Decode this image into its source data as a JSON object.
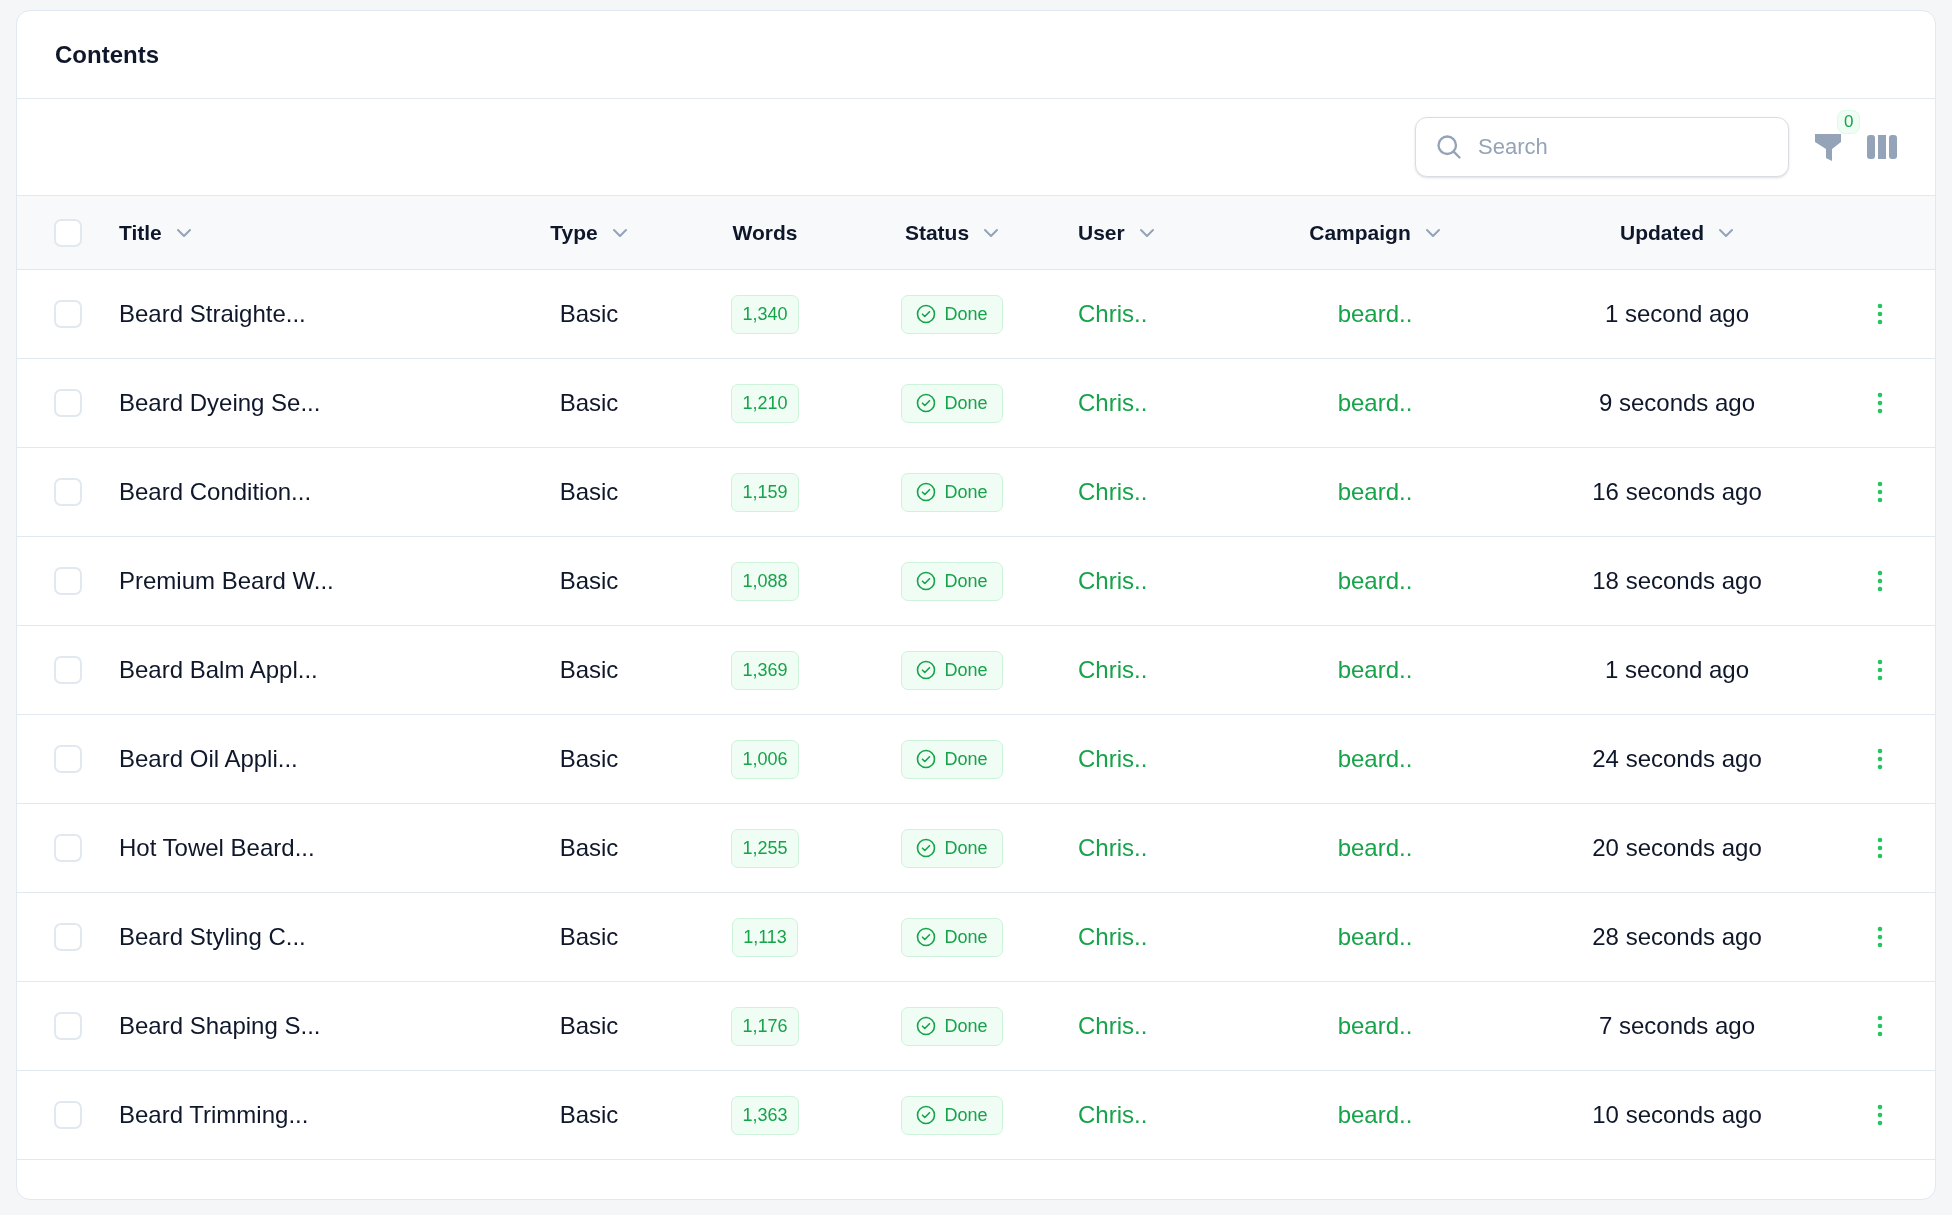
{
  "card_title": "Contents",
  "search": {
    "placeholder": "Search"
  },
  "filter_count": "0",
  "select_all": {
    "checked": false
  },
  "columns": [
    {
      "label": "Title",
      "sortable": true
    },
    {
      "label": "Type",
      "sortable": true
    },
    {
      "label": "Words",
      "sortable": false
    },
    {
      "label": "Status",
      "sortable": true
    },
    {
      "label": "User",
      "sortable": true
    },
    {
      "label": "Campaign",
      "sortable": true
    },
    {
      "label": "Updated",
      "sortable": true
    }
  ],
  "rows": [
    {
      "checked": false,
      "title": "Beard Straighte...",
      "type": "Basic",
      "words": "1,340",
      "status": "Done",
      "user": "Chris..",
      "campaign": "beard..",
      "updated": "1 second ago"
    },
    {
      "checked": false,
      "title": "Beard Dyeing Se...",
      "type": "Basic",
      "words": "1,210",
      "status": "Done",
      "user": "Chris..",
      "campaign": "beard..",
      "updated": "9 seconds ago"
    },
    {
      "checked": false,
      "title": "Beard Condition...",
      "type": "Basic",
      "words": "1,159",
      "status": "Done",
      "user": "Chris..",
      "campaign": "beard..",
      "updated": "16 seconds ago"
    },
    {
      "checked": false,
      "title": "Premium Beard W...",
      "type": "Basic",
      "words": "1,088",
      "status": "Done",
      "user": "Chris..",
      "campaign": "beard..",
      "updated": "18 seconds ago"
    },
    {
      "checked": false,
      "title": "Beard Balm Appl...",
      "type": "Basic",
      "words": "1,369",
      "status": "Done",
      "user": "Chris..",
      "campaign": "beard..",
      "updated": "1 second ago"
    },
    {
      "checked": false,
      "title": "Beard Oil Appli...",
      "type": "Basic",
      "words": "1,006",
      "status": "Done",
      "user": "Chris..",
      "campaign": "beard..",
      "updated": "24 seconds ago"
    },
    {
      "checked": false,
      "title": "Hot Towel Beard...",
      "type": "Basic",
      "words": "1,255",
      "status": "Done",
      "user": "Chris..",
      "campaign": "beard..",
      "updated": "20 seconds ago"
    },
    {
      "checked": false,
      "title": "Beard Styling C...",
      "type": "Basic",
      "words": "1,113",
      "status": "Done",
      "user": "Chris..",
      "campaign": "beard..",
      "updated": "28 seconds ago"
    },
    {
      "checked": false,
      "title": "Beard Shaping S...",
      "type": "Basic",
      "words": "1,176",
      "status": "Done",
      "user": "Chris..",
      "campaign": "beard..",
      "updated": "7 seconds ago"
    },
    {
      "checked": false,
      "title": "Beard Trimming...",
      "type": "Basic",
      "words": "1,363",
      "status": "Done",
      "user": "Chris..",
      "campaign": "beard..",
      "updated": "10 seconds ago"
    }
  ]
}
